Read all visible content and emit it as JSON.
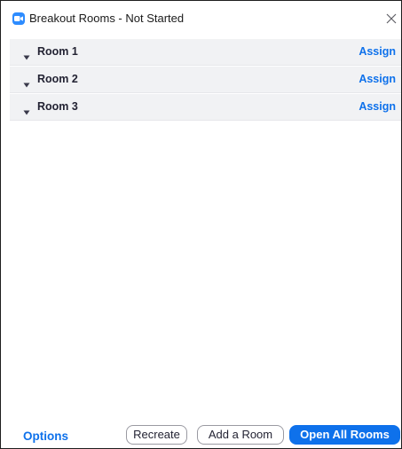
{
  "window": {
    "title": "Breakout Rooms - Not Started",
    "app_icon": "zoom-video-camera-icon",
    "close_icon": "close-x-icon"
  },
  "rooms": [
    {
      "name": "Room 1",
      "action": "Assign"
    },
    {
      "name": "Room 2",
      "action": "Assign"
    },
    {
      "name": "Room 3",
      "action": "Assign"
    }
  ],
  "footer": {
    "options_label": "Options",
    "recreate_label": "Recreate",
    "add_room_label": "Add a Room",
    "open_all_label": "Open All Rooms"
  },
  "colors": {
    "accent": "#0e71eb",
    "app_icon": "#2d8cff",
    "room_row_background": "#f1f2f4",
    "window_border": "#1e1e1e"
  }
}
